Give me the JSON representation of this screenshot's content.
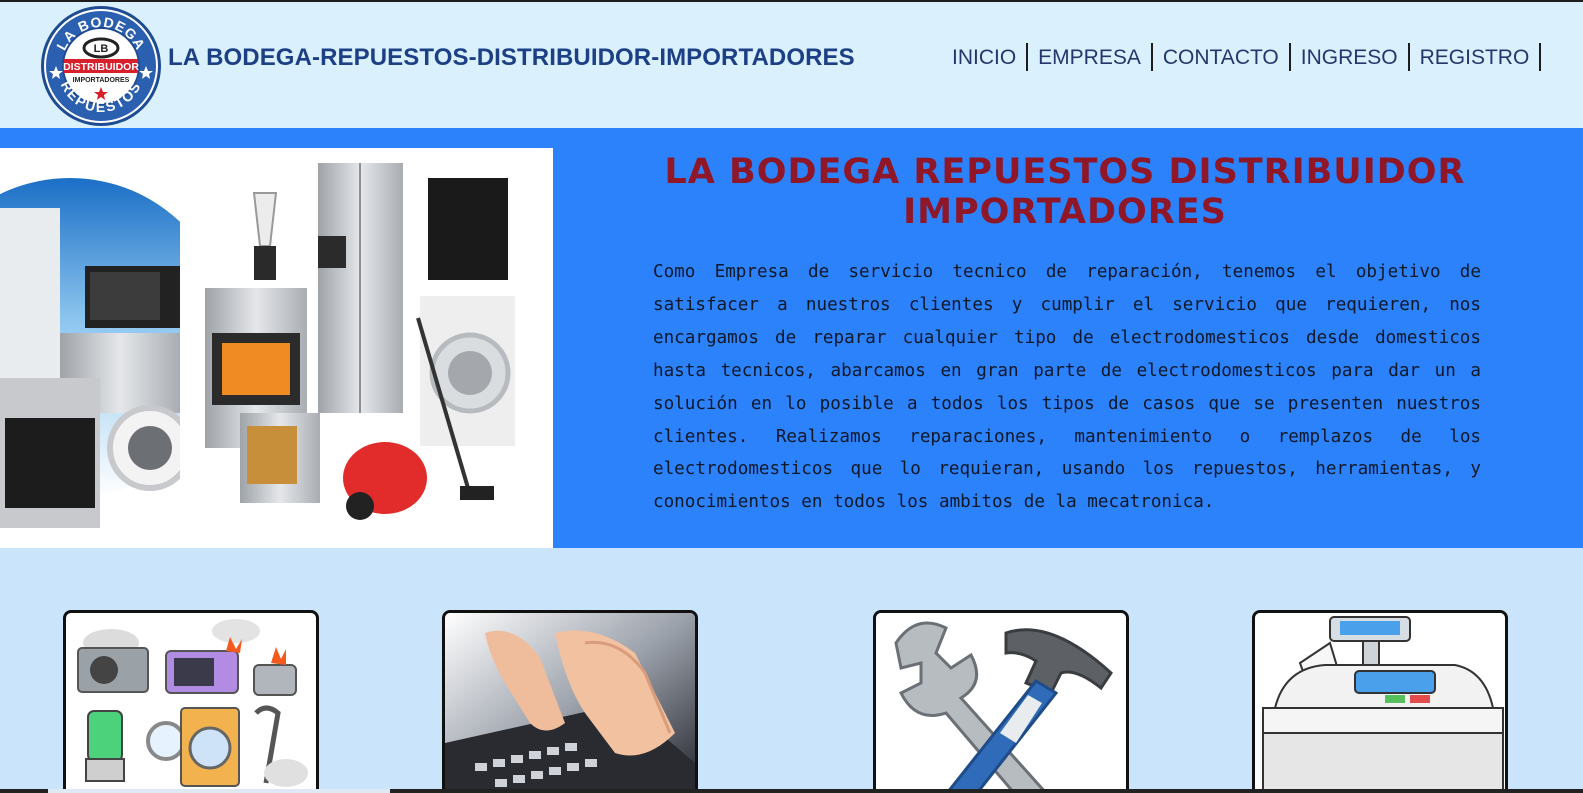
{
  "header": {
    "logo_text": {
      "top": "LA BODEGA",
      "bottom": "REPUESTOS",
      "center": "DISTRIBUIDOR",
      "sub": "IMPORTADORES"
    },
    "site_title": "LA BODEGA-REPUESTOS-DISTRIBUIDOR-IMPORTADORES",
    "nav": [
      {
        "label": "INICIO"
      },
      {
        "label": "EMPRESA"
      },
      {
        "label": "CONTACTO"
      },
      {
        "label": "INGRESO"
      },
      {
        "label": "REGISTRO"
      }
    ]
  },
  "hero": {
    "heading_line1": "La Bodega Repuestos Distribuidor",
    "heading_line2": "Importadores",
    "description": "Como Empresa de servicio tecnico de reparación, tenemos el objetivo de satisfacer a nuestros clientes y cumplir el servicio que requieren, nos encargamos de reparar cualquier tipo de electrodomesticos desde domesticos hasta tecnicos, abarcamos en gran parte de electrodomesticos para dar un a solución en lo posible a todos los tipos de casos que se presenten nuestros clientes. Realizamos reparaciones, mantenimiento o remplazos de los electrodomesticos que lo requieran, usando los repuestos, herramientas, y conocimientos en todos los ambitos de la mecatronica."
  },
  "colors": {
    "header_bg": "#daf1fd",
    "hero_bg": "#2b82fb",
    "page_bg": "#c9e4fb",
    "title_blue": "#1c3f86",
    "heading_red": "#8f1727"
  },
  "cards": [
    {
      "icon": "broken-appliances-icon"
    },
    {
      "icon": "typing-keyboard-icon"
    },
    {
      "icon": "wrench-hammer-icon"
    },
    {
      "icon": "cash-register-icon"
    }
  ]
}
